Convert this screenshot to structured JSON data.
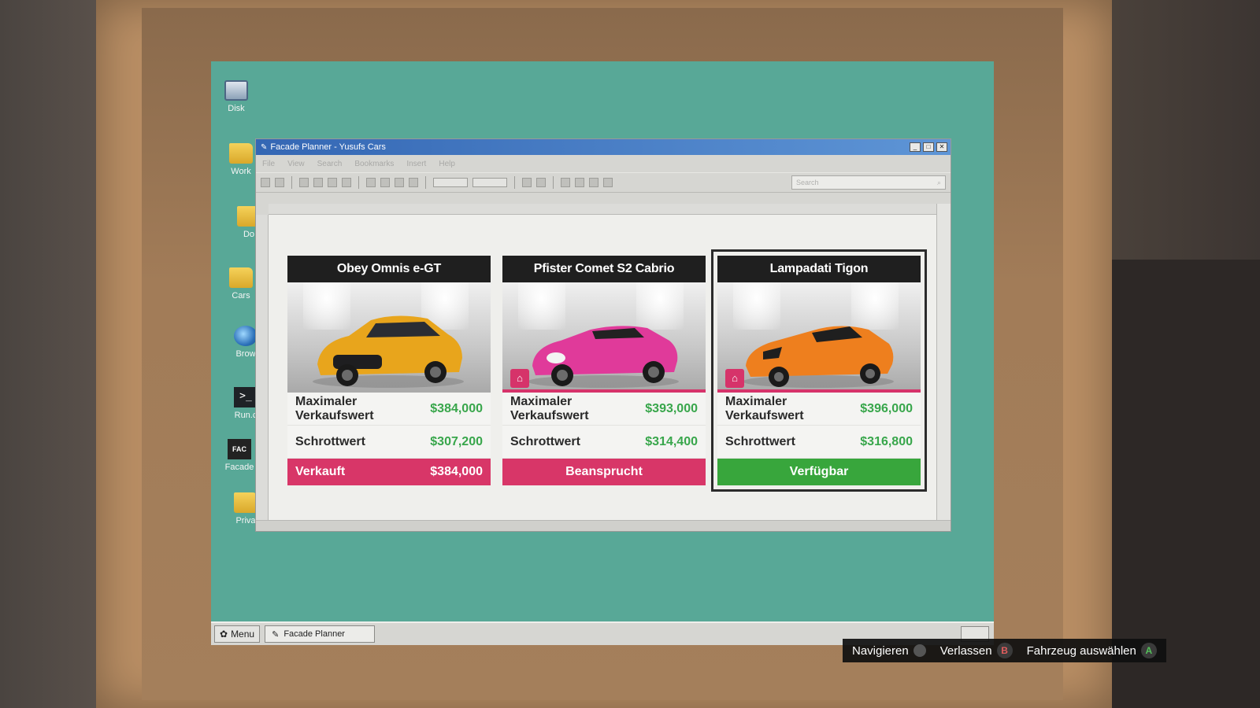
{
  "desktop": {
    "icons": [
      {
        "label": "Disk",
        "icon": "disk-icon"
      },
      {
        "label": "Work",
        "icon": "folder-icon"
      },
      {
        "label": "Do",
        "icon": "folder-icon"
      },
      {
        "label": "Cars",
        "icon": "folder-icon"
      },
      {
        "label": "Brow",
        "icon": "globe-icon"
      },
      {
        "label": "Run.c",
        "icon": "terminal-icon"
      },
      {
        "label": "Facade",
        "icon": "facade-icon"
      },
      {
        "label": "Priva",
        "icon": "folder-icon"
      }
    ]
  },
  "window": {
    "title": "Facade Planner - Yusufs Cars",
    "menu": [
      "File",
      "View",
      "Search",
      "Bookmarks",
      "Insert",
      "Help"
    ],
    "search_placeholder": "Search"
  },
  "cards": [
    {
      "name": "Obey Omnis e-GT",
      "car_color": "#e8a51c",
      "max_sell_label": "Maximaler Verkaufswert",
      "max_sell_value": "$384,000",
      "scrap_label": "Schrottwert",
      "scrap_value": "$307,200",
      "status_label": "Verkauft",
      "status_value": "$384,000",
      "status_color": "#d83668"
    },
    {
      "name": "Pfister Comet S2 Cabrio",
      "car_color": "#e03a9a",
      "max_sell_label": "Maximaler Verkaufswert",
      "max_sell_value": "$393,000",
      "scrap_label": "Schrottwert",
      "scrap_value": "$314,400",
      "status_label": "Beansprucht",
      "status_color": "#d83668"
    },
    {
      "name": "Lampadati Tigon",
      "car_color": "#ee7f1e",
      "max_sell_label": "Maximaler Verkaufswert",
      "max_sell_value": "$396,000",
      "scrap_label": "Schrottwert",
      "scrap_value": "$316,800",
      "status_label": "Verfügbar",
      "status_color": "#38a63c"
    }
  ],
  "taskbar": {
    "menu_label": "Menu",
    "app_label": "Facade Planner"
  },
  "hints": {
    "navigate": "Navigieren",
    "leave": "Verlassen",
    "leave_button": "B",
    "select": "Fahrzeug auswählen",
    "select_button": "A"
  }
}
